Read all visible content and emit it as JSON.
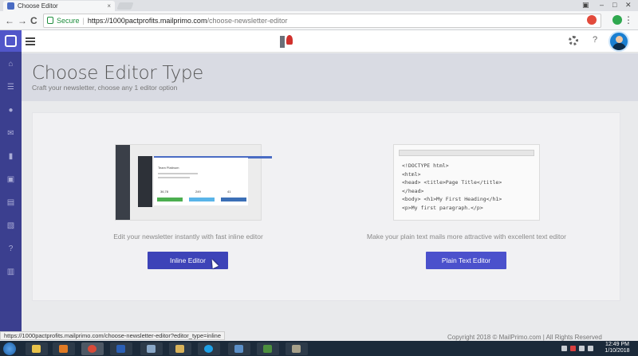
{
  "browser": {
    "tab_title": "Choose Editor",
    "tab_close": "×",
    "secure_label": "Secure",
    "url_host": "https://1000pactprofits.mailprimo.com",
    "url_path": "/choose-newsletter-editor",
    "window_minimize": "–",
    "window_maximize": "□",
    "window_close": "✕",
    "back_glyph": "←",
    "forward_glyph": "→",
    "reload_glyph": "C",
    "menu_glyph": "⋮"
  },
  "app": {
    "help_glyph": "?",
    "sidebar_icons": [
      "home-icon",
      "list-icon",
      "user-icon",
      "mail-icon",
      "chart-icon",
      "layout-icon",
      "book-icon",
      "image-icon",
      "help-icon",
      "gift-icon"
    ],
    "sidebar_glyphs": [
      "⌂",
      "☰",
      "●",
      "✉",
      "▮",
      "▣",
      "▤",
      "▧",
      "?",
      "▥"
    ]
  },
  "page": {
    "title": "Choose Editor Type",
    "subtitle": "Craft your newsletter, choose any 1 editor option"
  },
  "editors": [
    {
      "description": "Edit your newsletter instantly with fast inline editor",
      "button_label": "Inline Editor",
      "preview": {
        "card_heading": "Team Platinum",
        "stats": [
          "36,78",
          "249",
          "41"
        ]
      }
    },
    {
      "description": "Make your plain text mails more attractive with excellent text editor",
      "button_label": "Plain Text Editor",
      "preview": {
        "code_lines": [
          "<!DOCTYPE html>",
          "<html>",
          "<head> <title>Page Title</title>",
          "</head>",
          "<body> <h1>My First Heading</h1>",
          "<p>My first paragraph.</p>"
        ]
      }
    }
  ],
  "status_url": "https://1000pactprofits.mailprimo.com/choose-newsletter-editor?editor_type=inline",
  "footer": {
    "copyright": "Copyright 2018 ©   MailPrimo.com | All Rights Reserved"
  },
  "taskbar": {
    "time": "12:49 PM",
    "date": "1/10/2018"
  },
  "colors": {
    "sidebar": "#3b3f8f",
    "primary_button": "#4b51cc",
    "title_band": "#d9dbe3"
  }
}
